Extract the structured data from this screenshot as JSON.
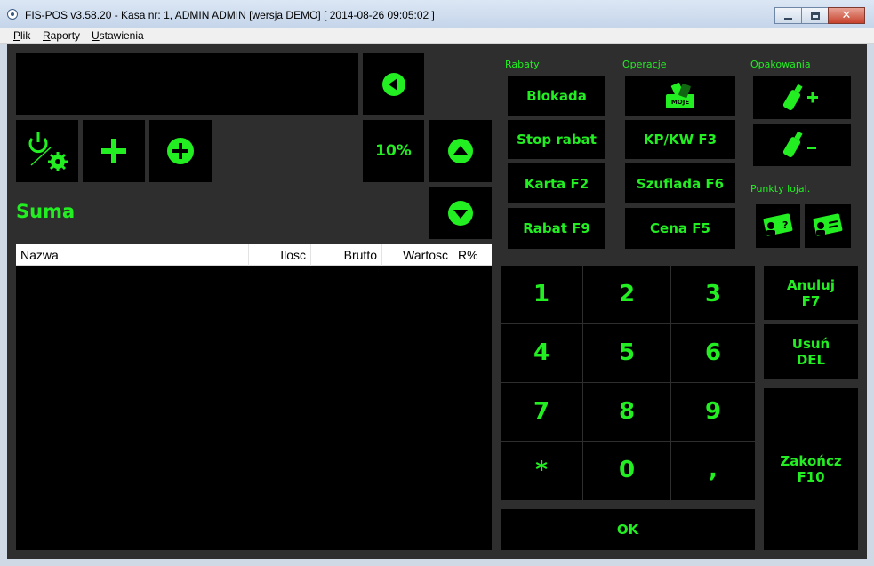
{
  "window": {
    "title": "FIS-POS v3.58.20 - Kasa nr: 1, ADMIN ADMIN [wersja DEMO]  [ 2014-08-26 09:05:02 ]"
  },
  "menu": [
    "Plik",
    "Raporty",
    "Ustawienia"
  ],
  "display": {
    "discount_label": "10%",
    "suma_label": "Suma"
  },
  "table": {
    "columns": [
      "Nazwa",
      "Ilosc",
      "Brutto",
      "Wartosc",
      "R%"
    ]
  },
  "sections": {
    "rabaty": "Rabaty",
    "operacje": "Operacje",
    "opakowania": "Opakowania",
    "punkty": "Punkty lojal."
  },
  "rabaty_buttons": [
    "Blokada",
    "Stop rabat",
    "Karta F2",
    "Rabat F9"
  ],
  "operacje_buttons": {
    "logo": "MOJE",
    "kpkw": "KP/KW F3",
    "szuflada": "Szuflada F6",
    "cena": "Cena F5"
  },
  "opakowania_buttons": {
    "add": "+",
    "remove": "-"
  },
  "keypad": [
    "1",
    "2",
    "3",
    "4",
    "5",
    "6",
    "7",
    "8",
    "9",
    "*",
    "0",
    ","
  ],
  "ok_label": "OK",
  "side_buttons": {
    "anuluj": [
      "Anuluj",
      "F7"
    ],
    "usun": [
      "Usuń",
      "DEL"
    ],
    "zakoncz": [
      "Zakończ",
      "F10"
    ]
  },
  "colors": {
    "accent": "#22ee22",
    "panel": "#2e2e2e",
    "button": "#000000"
  }
}
